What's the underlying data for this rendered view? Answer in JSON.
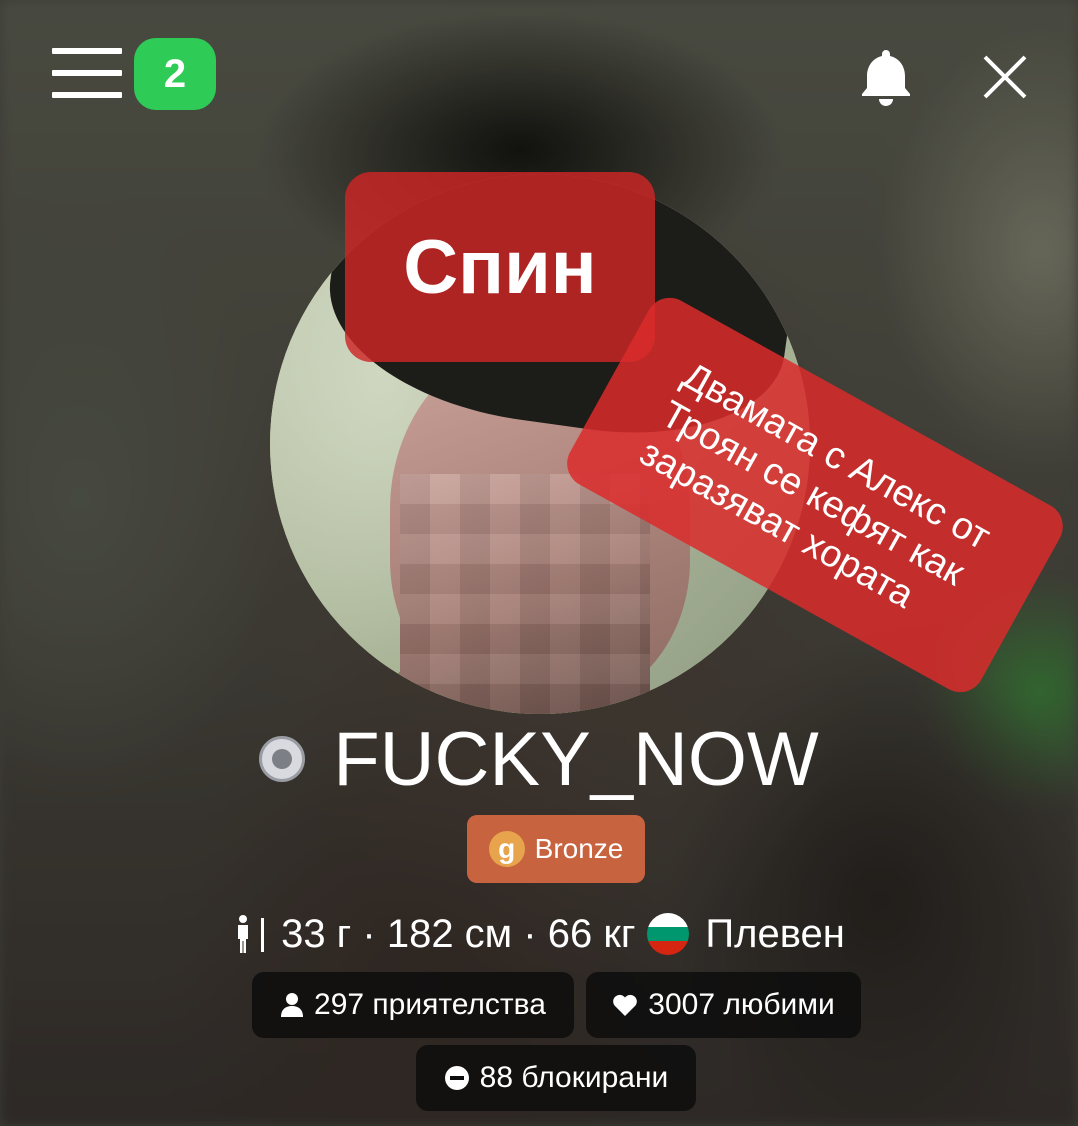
{
  "header": {
    "notification_count": "2",
    "icons": {
      "menu": "hamburger-menu-icon",
      "notifications": "bell-icon",
      "close": "close-icon"
    }
  },
  "overlays": {
    "spin": "Спин",
    "promo_lines": [
      "Двамата с Алекс от",
      "Троян се кефят как",
      "заразяват хората"
    ]
  },
  "profile": {
    "username": "FUCKY_NOW",
    "status": "offline",
    "tier": "Bronze",
    "tier_icon_letter": "g",
    "info": "33 г · 182 см · 66 кг",
    "city": "Плевен",
    "country_flag": "bulgaria-flag"
  },
  "stats": {
    "friends": "297 приятелства",
    "favorites": "3007 любими",
    "blocked": "88 блокирани"
  },
  "colors": {
    "badge_green": "#2ecc57",
    "overlay_red": "#cd2626",
    "tier_bronze": "#c7643f",
    "pill_bg": "#0c0c0c"
  }
}
